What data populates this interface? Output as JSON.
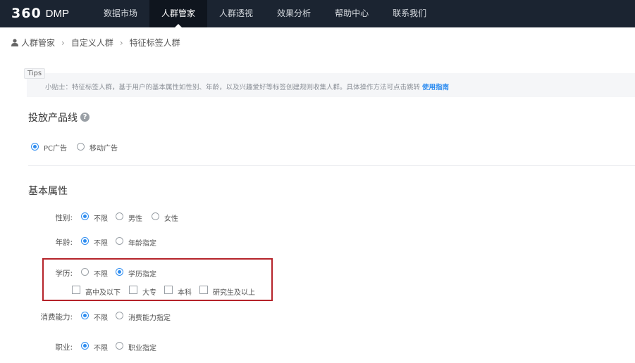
{
  "header": {
    "logo_number": "360",
    "logo_product": "DMP",
    "nav": [
      {
        "label": "数据市场"
      },
      {
        "label": "人群管家"
      },
      {
        "label": "人群透视"
      },
      {
        "label": "效果分析"
      },
      {
        "label": "帮助中心"
      },
      {
        "label": "联系我们"
      }
    ],
    "active_index": 1
  },
  "breadcrumb": {
    "items": [
      "人群管家",
      "自定义人群",
      "特征标签人群"
    ],
    "separator": "›"
  },
  "tips": {
    "tag": "Tips",
    "text": "小贴士：特征标签人群，基于用户的基本属性如性别、年龄，以及兴趣爱好等标签创建规则收集人群。具体操作方法可点击跳转",
    "link": "使用指南"
  },
  "product_line": {
    "title": "投放产品线",
    "help_icon": "question-circle-icon",
    "options": [
      "PC广告",
      "移动广告"
    ],
    "selected": "PC广告"
  },
  "basic_attributes": {
    "title": "基本属性",
    "gender": {
      "label": "性别:",
      "options": [
        "不限",
        "男性",
        "女性"
      ],
      "selected": "不限"
    },
    "age": {
      "label": "年龄:",
      "options": [
        "不限",
        "年龄指定"
      ],
      "selected": "不限"
    },
    "education": {
      "label": "学历:",
      "options": [
        "不限",
        "学历指定"
      ],
      "selected": "学历指定",
      "choices": [
        "高中及以下",
        "大专",
        "本科",
        "研究生及以上"
      ]
    },
    "consumption": {
      "label": "消费能力:",
      "options": [
        "不限",
        "消费能力指定"
      ],
      "selected": "不限"
    },
    "occupation": {
      "label": "职业:",
      "options": [
        "不限",
        "职业指定"
      ],
      "selected": "不限"
    }
  },
  "colors": {
    "topbar": "#1b2431",
    "accent": "#2d8cf0",
    "highlight_border": "#b5232a"
  }
}
